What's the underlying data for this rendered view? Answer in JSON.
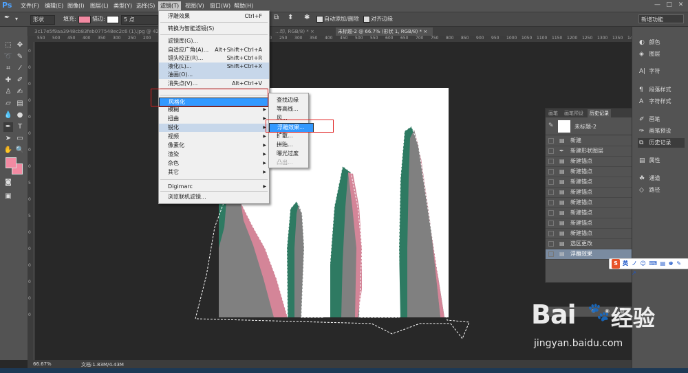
{
  "app": {
    "logo": "Ps"
  },
  "menubar": {
    "items": [
      "文件(F)",
      "编辑(E)",
      "图像(I)",
      "图层(L)",
      "类型(Y)",
      "选择(S)",
      "滤镜(T)",
      "视图(V)",
      "窗口(W)",
      "帮助(H)"
    ],
    "window_buttons": [
      "—",
      "□",
      "✕"
    ]
  },
  "options_bar": {
    "mode": "形状",
    "fill_label": "填充:",
    "fill_color": "#f28aa2",
    "stroke_label": "描边:",
    "stroke_size": "5 点",
    "auto_add_delete": "自动添加/删除",
    "align_edges": "对齐边缘",
    "workspace": "新增功能"
  },
  "tabs": [
    {
      "label": "3c17e5f9aa3948cb83feb077548ec2c6 (1).jpg @ 42…"
    },
    {
      "label": "…印, RGB/8) *  ×"
    },
    {
      "label": "未标题-2 @ 66.7% (形状 1, RGB/8) *  ×"
    }
  ],
  "ruler_h": [
    "550",
    "500",
    "450",
    "400",
    "350",
    "300",
    "250",
    "200",
    "150",
    "100",
    "50",
    "0",
    "50",
    "100",
    "150",
    "200",
    "250",
    "300",
    "350",
    "400",
    "450",
    "500",
    "550",
    "600",
    "650",
    "700",
    "750",
    "800",
    "850",
    "900",
    "950",
    "1000",
    "1050",
    "1100",
    "1150",
    "1200",
    "1250",
    "1300",
    "1350",
    "1400",
    "1450"
  ],
  "ruler_v": [
    "0",
    "0",
    "0",
    "0",
    "0",
    "0",
    "0",
    "0",
    "5",
    "0",
    "5",
    "0",
    "0",
    "0",
    "0",
    "0",
    "0"
  ],
  "filter_menu": {
    "items": [
      {
        "label": "浮雕效果",
        "shortcut": "Ctrl+F"
      },
      {
        "label": "转换为智能滤镜(S)"
      },
      {
        "label": "滤镜库(G)..."
      },
      {
        "label": "自适应广角(A)...",
        "shortcut": "Alt+Shift+Ctrl+A"
      },
      {
        "label": "镜头校正(R)...",
        "shortcut": "Shift+Ctrl+R"
      },
      {
        "label": "液化(L)...",
        "shortcut": "Shift+Ctrl+X"
      },
      {
        "label": "油画(O)..."
      },
      {
        "label": "消失点(V)...",
        "shortcut": "Alt+Ctrl+V"
      },
      {
        "label": "风格化",
        "arrow": "▶"
      },
      {
        "label": "模糊",
        "arrow": "▶"
      },
      {
        "label": "扭曲",
        "arrow": "▶"
      },
      {
        "label": "锐化",
        "arrow": "▶"
      },
      {
        "label": "视频",
        "arrow": "▶"
      },
      {
        "label": "像素化",
        "arrow": "▶"
      },
      {
        "label": "渲染",
        "arrow": "▶"
      },
      {
        "label": "杂色",
        "arrow": "▶"
      },
      {
        "label": "其它",
        "arrow": "▶"
      },
      {
        "label": "Digimarc",
        "arrow": "▶"
      },
      {
        "label": "浏览联机滤镜..."
      }
    ]
  },
  "stylize_submenu": {
    "items": [
      "查找边缘",
      "等高线...",
      "风...",
      "浮雕效果...",
      "扩散...",
      "拼贴...",
      "曝光过度",
      "凸出..."
    ]
  },
  "history_panel": {
    "tabs": [
      "画笔",
      "画笔预设",
      "历史记录"
    ],
    "snapshot": "未标题-2",
    "items": [
      "新建",
      "新建形状图层",
      "新建锚点",
      "新建锚点",
      "新建锚点",
      "新建锚点",
      "新建锚点",
      "新建锚点",
      "新建锚点",
      "新建锚点",
      "选区更改",
      "浮雕效果"
    ],
    "footer_icons": [
      "⊕",
      "◉",
      "🗑"
    ]
  },
  "right_dock": {
    "items": [
      "颜色",
      "图层",
      "字符",
      "段落样式",
      "字符样式",
      "画笔",
      "画笔预设",
      "历史记录",
      "属性",
      "通道",
      "路径"
    ]
  },
  "status_bar": {
    "zoom": "66.67%",
    "doc": "文档:1.83M/4.43M"
  },
  "ime": {
    "label": "英",
    "symbols": "ノ ☺ ⌨ ▤ ♚ ✎ ↗"
  },
  "watermark": {
    "brand": "Bai",
    "brand2": "经验",
    "url": "jingyan.baidu.com"
  },
  "colors": {
    "pink": "#f28aa2",
    "green": "#2e7a62",
    "gray": "#808080",
    "highlight": "#3399ff"
  }
}
